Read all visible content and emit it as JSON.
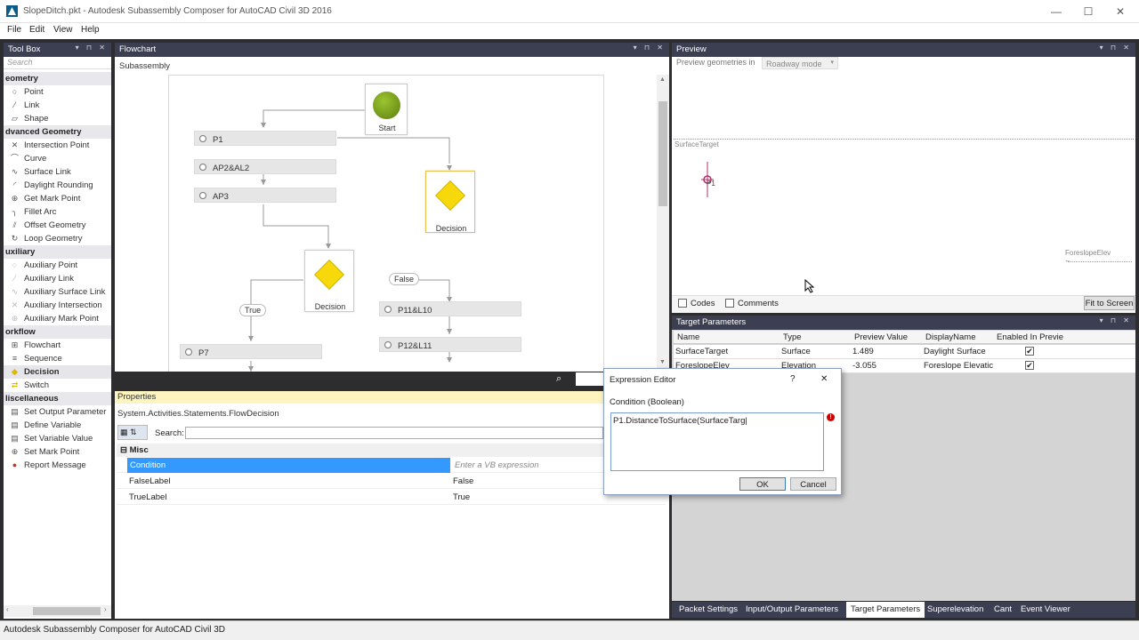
{
  "window": {
    "title": "SlopeDitch.pkt - Autodesk Subassembly Composer for AutoCAD Civil 3D 2016",
    "min": "—",
    "max": "☐",
    "close": "✕"
  },
  "menu": [
    "File",
    "Edit",
    "View",
    "Help"
  ],
  "toolbox": {
    "title": "Tool Box",
    "controls": "▾ ⊓ ✕",
    "search_placeholder": "Search",
    "categories": [
      {
        "name": "eometry",
        "items": [
          "Point",
          "Link",
          "Shape"
        ]
      },
      {
        "name": "dvanced Geometry",
        "items": [
          "Intersection Point",
          "Curve",
          "Surface Link",
          "Daylight Rounding",
          "Get Mark Point",
          "Fillet Arc",
          "Offset Geometry",
          "Loop Geometry"
        ]
      },
      {
        "name": "uxiliary",
        "items": [
          "Auxiliary Point",
          "Auxiliary Link",
          "Auxiliary Surface Link",
          "Auxiliary Intersection",
          "Auxiliary Mark Point"
        ]
      },
      {
        "name": "orkflow",
        "items": [
          "Flowchart",
          "Sequence",
          "Decision",
          "Switch"
        ]
      },
      {
        "name": "liscellaneous",
        "items": [
          "Set Output Parameter",
          "Define Variable",
          "Set Variable Value",
          "Set Mark Point",
          "Report Message"
        ]
      }
    ]
  },
  "flowchart": {
    "title": "Flowchart",
    "controls": "▾ ⊓ ✕",
    "breadcrumb": "Subassembly",
    "start_label": "Start",
    "decision_label": "Decision",
    "decision2_label": "Decision",
    "false_label": "False",
    "true_label": "True",
    "nodes": {
      "p1": "P1",
      "ap2": "AP2&AL2",
      "ap3": "AP3",
      "p11": "P11&L10",
      "p12": "P12&L11",
      "p7": "P7"
    }
  },
  "properties": {
    "title": "Properties",
    "type": "System.Activities.Statements.FlowDecision",
    "search_label": "Search:",
    "group": "Misc",
    "rows": [
      {
        "name": "Condition",
        "value": "Enter a VB expression"
      },
      {
        "name": "FalseLabel",
        "value": "False"
      },
      {
        "name": "TrueLabel",
        "value": "True"
      }
    ]
  },
  "preview": {
    "title": "Preview",
    "controls": "▾ ⊓ ✕",
    "geom_label": "Preview geometries in",
    "mode": "Roadway mode",
    "surface_target": "SurfaceTarget",
    "point_label": "P1",
    "foreslope": "ForeslopeElev",
    "codes_label": "Codes",
    "comments_label": "Comments",
    "fit_button": "Fit to Screen"
  },
  "target_params": {
    "title": "Target Parameters",
    "controls": "▾ ⊓ ✕",
    "columns": [
      "Name",
      "Type",
      "Preview Value",
      "DisplayName",
      "Enabled In Previe"
    ],
    "rows": [
      {
        "name": "SurfaceTarget",
        "type": "Surface",
        "value": "1.489",
        "display": "Daylight Surface",
        "enabled": true
      },
      {
        "name": "ForeslopeElev",
        "type": "Elevation",
        "value": "-3.055",
        "display": "Foreslope Elevatic",
        "enabled": true
      }
    ]
  },
  "bottom_tabs": [
    "Packet Settings",
    "Input/Output Parameters",
    "Target Parameters",
    "Superelevation",
    "Cant",
    "Event Viewer"
  ],
  "active_tab": "Target Parameters",
  "status": "Autodesk Subassembly Composer for AutoCAD Civil 3D",
  "dialog": {
    "title": "Expression Editor",
    "help": "?",
    "close": "✕",
    "subtitle": "Condition (Boolean)",
    "expression": "P1.DistanceToSurface(SurfaceTarg|",
    "error_icon": "!",
    "ok": "OK",
    "cancel": "Cancel"
  },
  "colors": {
    "dark": "#2d2d30",
    "pane_header": "#3c3f51",
    "decision": "#f7d90b",
    "start": "#7ea11a",
    "selection": "#3399ff"
  }
}
